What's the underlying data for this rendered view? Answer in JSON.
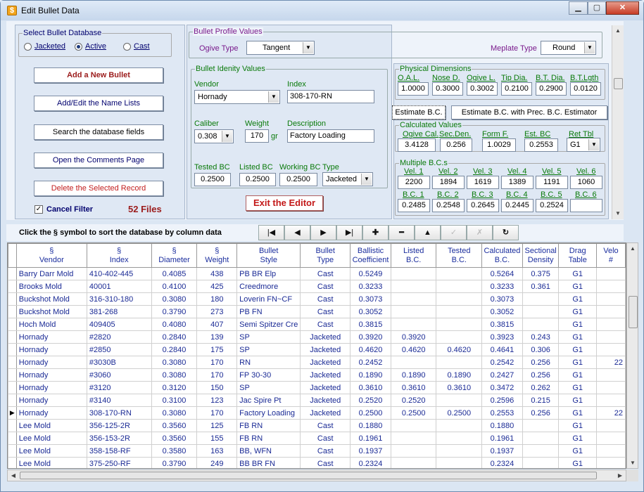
{
  "window": {
    "title": "Edit Bullet Data",
    "min": "▁",
    "max": "▢",
    "close": "✕"
  },
  "db": {
    "title": "Select Bullet Database",
    "opts": [
      "Jacketed",
      "Active",
      "Cast"
    ],
    "selected": 1
  },
  "buttons": {
    "add": "Add a New Bullet",
    "names": "Add/Edit the Name Lists",
    "search": "Search the database fields",
    "comments": "Open the Comments Page",
    "delete": "Delete the Selected Record",
    "exit": "Exit the Editor",
    "est": "Estimate B.C.",
    "est_prec": "Estimate B.C. with Prec. B.C. Estimator"
  },
  "filter": {
    "label": "Cancel Filter",
    "checked": true,
    "files": "52 Files"
  },
  "profile": {
    "title": "Bullet Profile Values",
    "ogive_label": "Ogive Type",
    "ogive": "Tangent",
    "meplate_label": "Meplate Type",
    "meplate": "Round"
  },
  "identity": {
    "title": "Bullet Idenity Values",
    "vendor_label": "Vendor",
    "vendor": "Hornady",
    "index_label": "Index",
    "index": "308-170-RN",
    "caliber_label": "Caliber",
    "caliber": "0.308",
    "weight_label": "Weight",
    "weight": "170",
    "gr": "gr",
    "desc_label": "Description",
    "desc": "Factory Loading",
    "tested_label": "Tested BC",
    "tested": "0.2500",
    "listed_label": "Listed BC",
    "listed": "0.2500",
    "working_label": "Working BC",
    "working": "0.2500",
    "type_label": "Type",
    "type": "Jacketed"
  },
  "physical": {
    "title": "Physical Dimensions",
    "labels": [
      "O.A.L.",
      "Nose D.",
      "Ogive L.",
      "Tip Dia.",
      "B.T. Dia.",
      "B.T.Lgth"
    ],
    "values": [
      "1.0000",
      "0.3000",
      "0.3002",
      "0.2100",
      "0.2900",
      "0.0120"
    ]
  },
  "calculated": {
    "title": "Calculated Values",
    "labels": [
      "Ogive Cal.",
      "Sec.Den.",
      "Form F.",
      "Est. BC",
      "Ret Tbl"
    ],
    "values": [
      "3.4128",
      "0.256",
      "1.0029",
      "0.2553",
      "G1"
    ]
  },
  "multiple": {
    "title": "Multiple B.C.s",
    "vel_labels": [
      "Vel. 1",
      "Vel. 2",
      "Vel. 3",
      "Vel. 4",
      "Vel. 5",
      "Vel. 6"
    ],
    "vels": [
      "2200",
      "1894",
      "1619",
      "1389",
      "1191",
      "1060"
    ],
    "bc_labels": [
      "B.C. 1",
      "B.C. 2",
      "B.C. 3",
      "B.C. 4",
      "B.C. 5",
      "B.C. 6"
    ],
    "bcs": [
      "0.2485",
      "0.2548",
      "0.2645",
      "0.2445",
      "0.2524",
      ""
    ]
  },
  "nav": {
    "hint": "Click the  §  symbol to sort the database by  column data",
    "buttons": [
      "|◀",
      "◀",
      "▶",
      "▶|",
      "✚",
      "━",
      "▲",
      "✓",
      "✗",
      "↻"
    ]
  },
  "grid": {
    "headers": [
      [
        "§",
        "Vendor"
      ],
      [
        "§",
        "Index"
      ],
      [
        "§",
        "Diameter"
      ],
      [
        "§",
        "Weight"
      ],
      [
        "Bullet",
        "Style"
      ],
      [
        "Bullet",
        "Type"
      ],
      [
        "Ballistic",
        "Coefficient"
      ],
      [
        "Listed",
        "B.C."
      ],
      [
        "Tested",
        "B.C."
      ],
      [
        "Calculated",
        "B.C."
      ],
      [
        "Sectional",
        "Density"
      ],
      [
        "Drag",
        "Table"
      ],
      [
        "Velo",
        "#"
      ]
    ],
    "current_row": 12,
    "rows": [
      [
        "Barry Darr Mold",
        "410-402-445",
        "0.4085",
        "438",
        "PB BR Elp",
        "Cast",
        "0.5249",
        "",
        "",
        "0.5264",
        "0.375",
        "G1",
        ""
      ],
      [
        "Brooks Mold",
        "40001",
        "0.4100",
        "425",
        "Creedmore",
        "Cast",
        "0.3233",
        "",
        "",
        "0.3233",
        "0.361",
        "G1",
        ""
      ],
      [
        "Buckshot Mold",
        "316-310-180",
        "0.3080",
        "180",
        "Loverin FN~CF",
        "Cast",
        "0.3073",
        "",
        "",
        "0.3073",
        "",
        "G1",
        ""
      ],
      [
        "Buckshot Mold",
        "381-268",
        "0.3790",
        "273",
        "PB FN",
        "Cast",
        "0.3052",
        "",
        "",
        "0.3052",
        "",
        "G1",
        ""
      ],
      [
        "Hoch Mold",
        "409405",
        "0.4080",
        "407",
        "Semi Spitzer Cre",
        "Cast",
        "0.3815",
        "",
        "",
        "0.3815",
        "",
        "G1",
        ""
      ],
      [
        "Hornady",
        "#2820",
        "0.2840",
        "139",
        "SP",
        "Jacketed",
        "0.3920",
        "0.3920",
        "",
        "0.3923",
        "0.243",
        "G1",
        ""
      ],
      [
        "Hornady",
        "#2850",
        "0.2840",
        "175",
        "SP",
        "Jacketed",
        "0.4620",
        "0.4620",
        "0.4620",
        "0.4641",
        "0.306",
        "G1",
        ""
      ],
      [
        "Hornady",
        "#3030B",
        "0.3080",
        "170",
        "RN",
        "Jacketed",
        "0.2452",
        "",
        "",
        "0.2542",
        "0.256",
        "G1",
        "22"
      ],
      [
        "Hornady",
        "#3060",
        "0.3080",
        "170",
        "FP 30-30",
        "Jacketed",
        "0.1890",
        "0.1890",
        "0.1890",
        "0.2427",
        "0.256",
        "G1",
        ""
      ],
      [
        "Hornady",
        "#3120",
        "0.3120",
        "150",
        "SP",
        "Jacketed",
        "0.3610",
        "0.3610",
        "0.3610",
        "0.3472",
        "0.262",
        "G1",
        ""
      ],
      [
        "Hornady",
        "#3140",
        "0.3100",
        "123",
        "Jac Spire Pt",
        "Jacketed",
        "0.2520",
        "0.2520",
        "",
        "0.2596",
        "0.215",
        "G1",
        ""
      ],
      [
        "Hornady",
        "308-170-RN",
        "0.3080",
        "170",
        "Factory Loading",
        "Jacketed",
        "0.2500",
        "0.2500",
        "0.2500",
        "0.2553",
        "0.256",
        "G1",
        "22"
      ],
      [
        "Lee Mold",
        "356-125-2R",
        "0.3560",
        "125",
        "FB RN",
        "Cast",
        "0.1880",
        "",
        "",
        "0.1880",
        "",
        "G1",
        ""
      ],
      [
        "Lee Mold",
        "356-153-2R",
        "0.3560",
        "155",
        "FB RN",
        "Cast",
        "0.1961",
        "",
        "",
        "0.1961",
        "",
        "G1",
        ""
      ],
      [
        "Lee Mold",
        "358-158-RF",
        "0.3580",
        "163",
        "BB, WFN",
        "Cast",
        "0.1937",
        "",
        "",
        "0.1937",
        "",
        "G1",
        ""
      ],
      [
        "Lee Mold",
        "375-250-RF",
        "0.3790",
        "249",
        "BB BR FN",
        "Cast",
        "0.2324",
        "",
        "",
        "0.2324",
        "",
        "G1",
        ""
      ]
    ]
  }
}
